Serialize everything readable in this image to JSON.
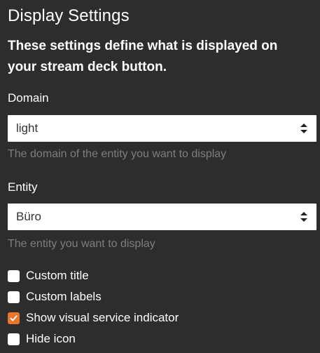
{
  "header": {
    "title": "Display Settings",
    "subtitle": "These settings define what is displayed on your stream deck button."
  },
  "domain": {
    "label": "Domain",
    "selected": "light",
    "help": "The domain of the entity you want to display"
  },
  "entity": {
    "label": "Entity",
    "selected": "Büro",
    "help": "The entity you want to display"
  },
  "options": [
    {
      "label": "Custom title",
      "checked": false
    },
    {
      "label": "Custom labels",
      "checked": false
    },
    {
      "label": "Show visual service indicator",
      "checked": true
    },
    {
      "label": "Hide icon",
      "checked": false
    }
  ],
  "colors": {
    "background": "#2d2d2d",
    "accent": "#e9762a",
    "help_text": "#7e7e7e"
  }
}
